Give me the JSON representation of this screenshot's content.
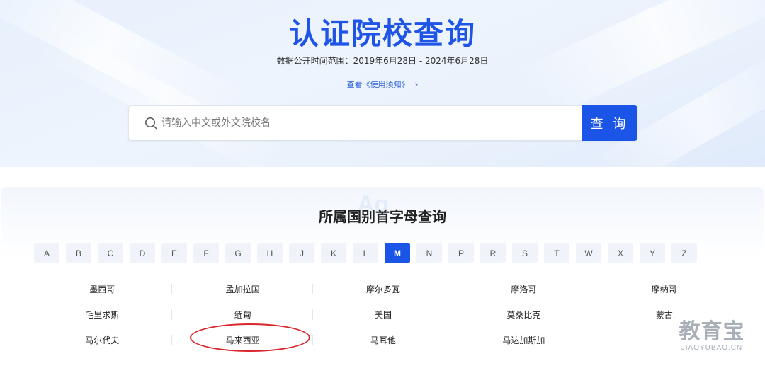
{
  "header": {
    "title": "认证院校查询",
    "date_range": "数据公开时间范围：2019年6月28日 - 2024年6月28日",
    "notice_link": "查看《使用须知》",
    "notice_chevron": "›"
  },
  "search": {
    "placeholder": "请输入中文或外文院校名",
    "value": "",
    "button_label": "查 询",
    "icon": "search-icon"
  },
  "alphabet": {
    "section_title": "所属国别首字母查询",
    "watermark": "Ag",
    "letters": [
      "A",
      "B",
      "C",
      "D",
      "E",
      "F",
      "G",
      "H",
      "J",
      "K",
      "L",
      "M",
      "N",
      "P",
      "R",
      "S",
      "T",
      "W",
      "X",
      "Y",
      "Z"
    ],
    "selected": "M"
  },
  "countries": {
    "rows": [
      [
        "墨西哥",
        "孟加拉国",
        "摩尔多瓦",
        "摩洛哥",
        "摩纳哥"
      ],
      [
        "毛里求斯",
        "缅甸",
        "美国",
        "莫桑比克",
        "蒙古"
      ],
      [
        "马尔代夫",
        "马来西亚",
        "马耳他",
        "马达加斯加",
        ""
      ]
    ],
    "highlighted": "马来西亚",
    "highlight_color": "#d8262c"
  },
  "watermark_logo": {
    "cn": "教育宝",
    "en": "JIAOYUBAO.CN"
  },
  "colors": {
    "accent": "#1a55e8",
    "title": "#1f55e6"
  }
}
